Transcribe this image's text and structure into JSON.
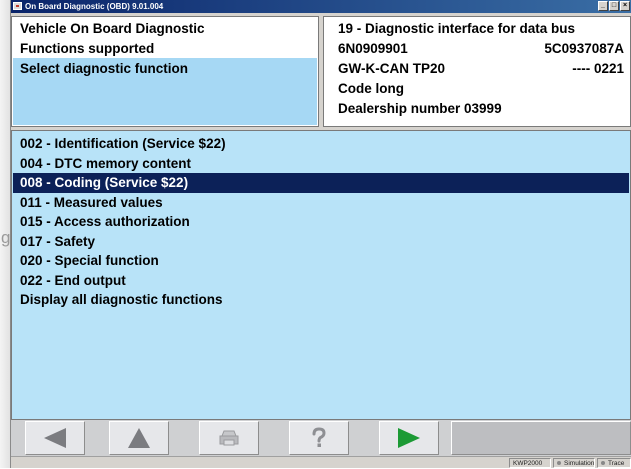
{
  "window": {
    "title": "On Board Diagnostic (OBD) 9.01.004",
    "bg_letter": "g",
    "minimize": "_",
    "maximize": "□",
    "close": "×"
  },
  "left_panel": {
    "line1": "Vehicle On Board Diagnostic",
    "line2": "Functions supported",
    "line3": "Select diagnostic function"
  },
  "right_panel": {
    "title": "19 - Diagnostic interface for data bus",
    "part_number": "6N0909901",
    "component_number": "5C0937087A",
    "component_name": "GW-K-CAN TP20",
    "version": "---- 0221",
    "coding": "Code long",
    "dealership": "Dealership number 03999"
  },
  "functions": [
    "002 - Identification (Service $22)",
    "004 - DTC memory content",
    "008 - Coding (Service $22)",
    "011 - Measured values",
    "015 - Access authorization",
    "017 - Safety",
    "020 - Special function",
    "022 - End output",
    "Display all diagnostic functions"
  ],
  "selected_function_index": 2,
  "toolbar": {
    "icons": [
      "back-arrow-icon",
      "up-arrow-icon",
      "print-icon",
      "help-icon",
      "go-arrow-icon"
    ]
  },
  "status": {
    "protocol": "KWP2000",
    "simulation": "Simulation",
    "trace": "Trace"
  },
  "colors": {
    "list_background": "#b8e3f8",
    "selection": "#0c2158",
    "header_highlight": "#a6d8f4",
    "go_arrow": "#1c9a35"
  }
}
